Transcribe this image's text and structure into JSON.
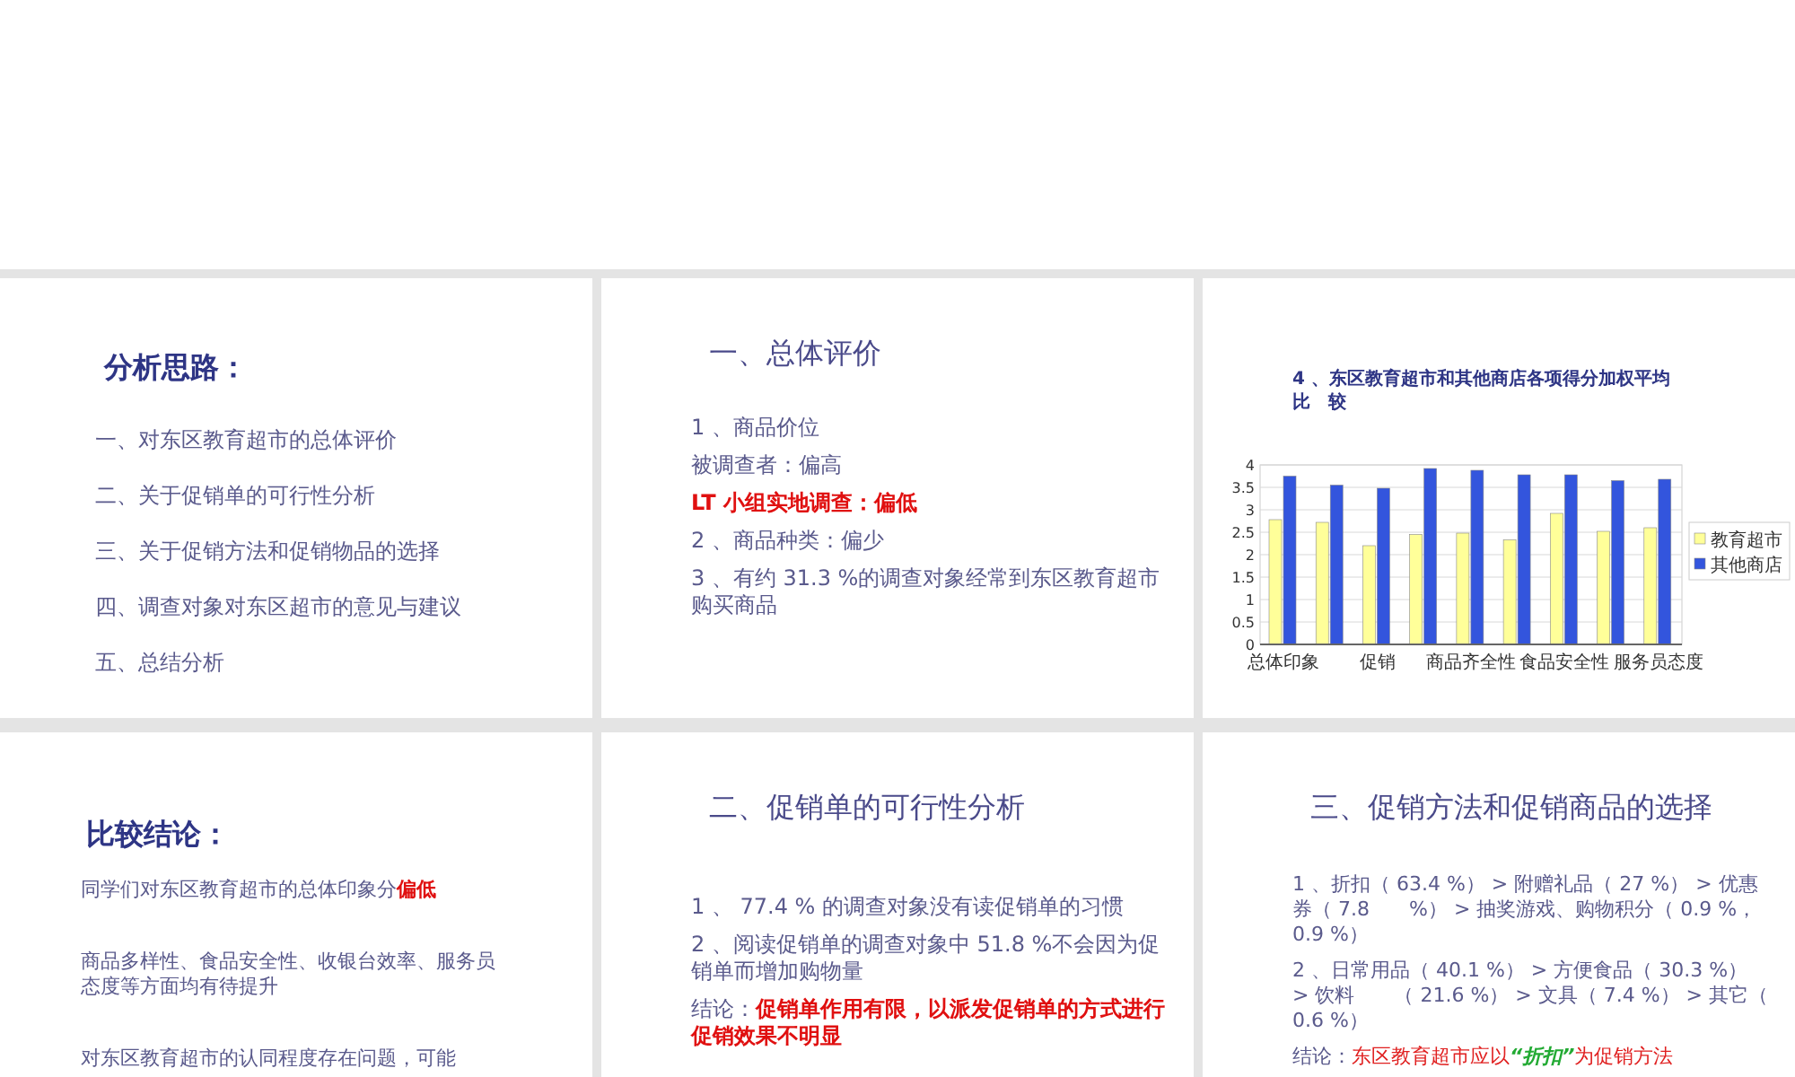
{
  "slides": [
    {
      "kind": "outline",
      "heading": {
        "text": "分析思路：",
        "kind": "bold"
      },
      "paragraphs": [
        {
          "parts": [
            {
              "text": "一、对东区教育超市的总体评价",
              "kind": "plain"
            }
          ]
        },
        {
          "parts": [
            {
              "text": "二、关于促销单的可行性分析",
              "kind": "plain"
            }
          ]
        },
        {
          "parts": [
            {
              "text": "三、关于促销方法和促销物品的选择",
              "kind": "plain"
            }
          ]
        },
        {
          "parts": [
            {
              "text": "四、调查对象对东区超市的意见与建议",
              "kind": "plain"
            }
          ]
        },
        {
          "parts": [
            {
              "text": "五、总结分析",
              "kind": "plain"
            }
          ]
        }
      ]
    },
    {
      "kind": "list",
      "heading": {
        "text": "一、总体评价",
        "kind": "light"
      },
      "paragraphs": [
        {
          "parts": [
            {
              "text": "1 、商品价位",
              "kind": "plain"
            }
          ]
        },
        {
          "parts": [
            {
              "text": "被调查者：偏高",
              "kind": "plain"
            }
          ]
        },
        {
          "parts": [
            {
              "text": "LT 小组实地调查：偏低",
              "kind": "alert"
            }
          ]
        },
        {
          "parts": [
            {
              "text": "2 、商品种类：偏少",
              "kind": "plain"
            }
          ]
        },
        {
          "parts": [
            {
              "text": "3 、有约 31.3 %的调查对象经常到东区教育超市购买商品",
              "kind": "plain"
            }
          ]
        }
      ]
    },
    {
      "kind": "chart",
      "heading": {
        "text": "4 、东区教育超市和其他商店各项得分加权平均比　较",
        "kind": "bold"
      },
      "chart_data": {
        "type": "bar",
        "grid": true,
        "legend": true,
        "categories": [
          "总体印象",
          null,
          "促销",
          null,
          "商品齐全性",
          null,
          "食品安全性",
          null,
          "服务员态度"
        ],
        "ylim": [
          0,
          4
        ],
        "yticks": [
          0,
          0.5,
          1,
          1.5,
          2,
          2.5,
          3,
          3.5,
          4
        ],
        "series": [
          {
            "name": "教育超市",
            "color": "#ffff99",
            "values": [
              2.78,
              2.72,
              2.2,
              2.45,
              2.48,
              2.33,
              2.92,
              2.52,
              2.6
            ]
          },
          {
            "name": "其他商店",
            "color": "#3355dd",
            "values": [
              3.75,
              3.55,
              3.48,
              3.92,
              3.88,
              3.78,
              3.78,
              3.65,
              3.68
            ]
          }
        ]
      }
    },
    {
      "kind": "conclusion",
      "heading": {
        "text": "比较结论：",
        "kind": "bold"
      },
      "paragraphs": [
        {
          "parts": [
            {
              "text": "同学们对东区教育超市的总体印象分",
              "kind": "plain"
            },
            {
              "text": "偏低",
              "kind": "alert"
            }
          ]
        },
        {
          "parts": [
            {
              "text": "商品多样性、食品安全性、收银台效率、服务员态度等方面均有待提升",
              "kind": "plain"
            }
          ]
        },
        {
          "parts": [
            {
              "text": "对东区教育超市的认同程度存在问题，可能",
              "kind": "plain"
            }
          ]
        }
      ]
    },
    {
      "kind": "list",
      "heading": {
        "text": "二、促销单的可行性分析",
        "kind": "light"
      },
      "paragraphs": [
        {
          "parts": [
            {
              "text": "1 、 77.4 % 的调查对象没有读促销单的习惯",
              "kind": "plain"
            }
          ]
        },
        {
          "parts": [
            {
              "text": "2 、阅读促销单的调查对象中 51.8 %不会因为促销单而增加购物量",
              "kind": "plain"
            }
          ]
        },
        {
          "parts": [
            {
              "text": "结论：",
              "kind": "plain"
            },
            {
              "text": "促销单作用有限，以派发促销单的方式进行促销效果不明显",
              "kind": "alert"
            }
          ]
        }
      ]
    },
    {
      "kind": "list",
      "heading": {
        "text": "三、促销方法和促销商品的选择",
        "kind": "light"
      },
      "paragraphs": [
        {
          "parts": [
            {
              "text": "1 、折扣（ 63.4 %） > 附赠礼品（ 27 %） > 优惠券（ 7.8　　%） > 抽奖游戏、购物积分（ 0.9 %， 0.9 %）",
              "kind": "plain"
            }
          ]
        },
        {
          "parts": [
            {
              "text": "2 、日常用品（ 40.1 %） > 方便食品（ 30.3 %） > 饮料　　（ 21.6 %） > 文具（ 7.4 %） > 其它（ 0.6 %）",
              "kind": "plain"
            }
          ]
        },
        {
          "parts": [
            {
              "text": "结论：",
              "kind": "plain"
            },
            {
              "text": "东区教育超市应以",
              "kind": "red"
            },
            {
              "text": "“折扣”",
              "kind": "highlight"
            },
            {
              "text": "为促销方法",
              "kind": "red"
            }
          ]
        }
      ]
    }
  ]
}
